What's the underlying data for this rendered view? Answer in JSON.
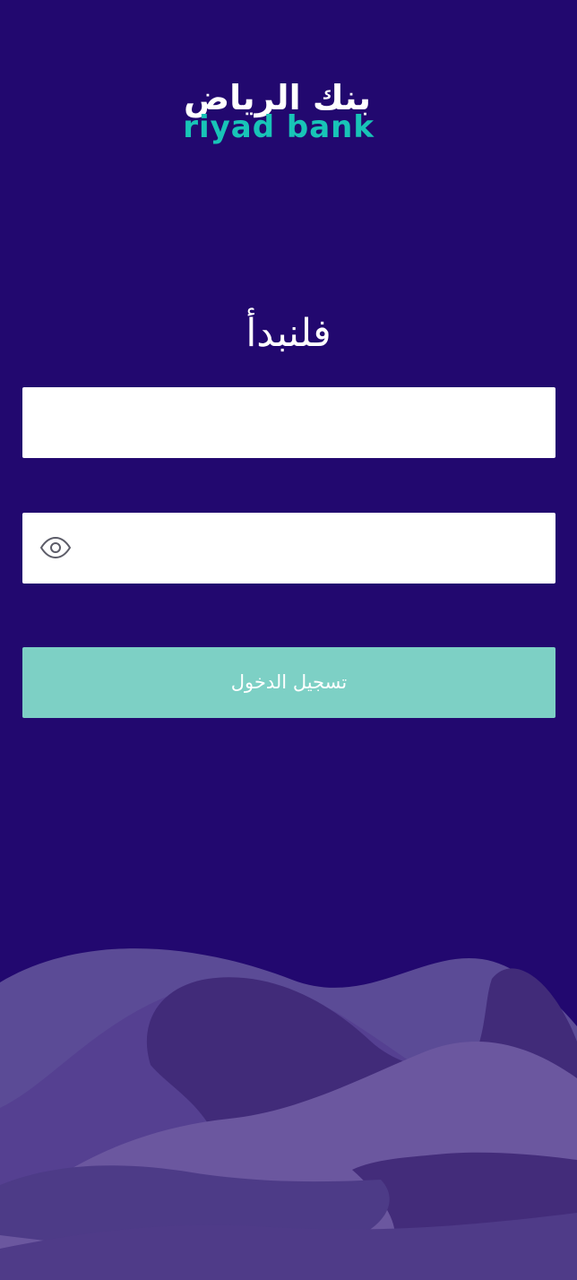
{
  "brand": {
    "arabic_name": "بنك الرياض",
    "english_name": "riyad bank",
    "colors": {
      "background": "#22086f",
      "english_logo": "#18c4b7",
      "login_button": "#7dd0c5"
    }
  },
  "page": {
    "title": "فلنبدأ"
  },
  "form": {
    "username": {
      "value": "",
      "placeholder": ""
    },
    "password": {
      "value": "",
      "placeholder": ""
    },
    "password_toggle_icon": "eye-icon",
    "login_label": "تسجيل الدخول"
  }
}
